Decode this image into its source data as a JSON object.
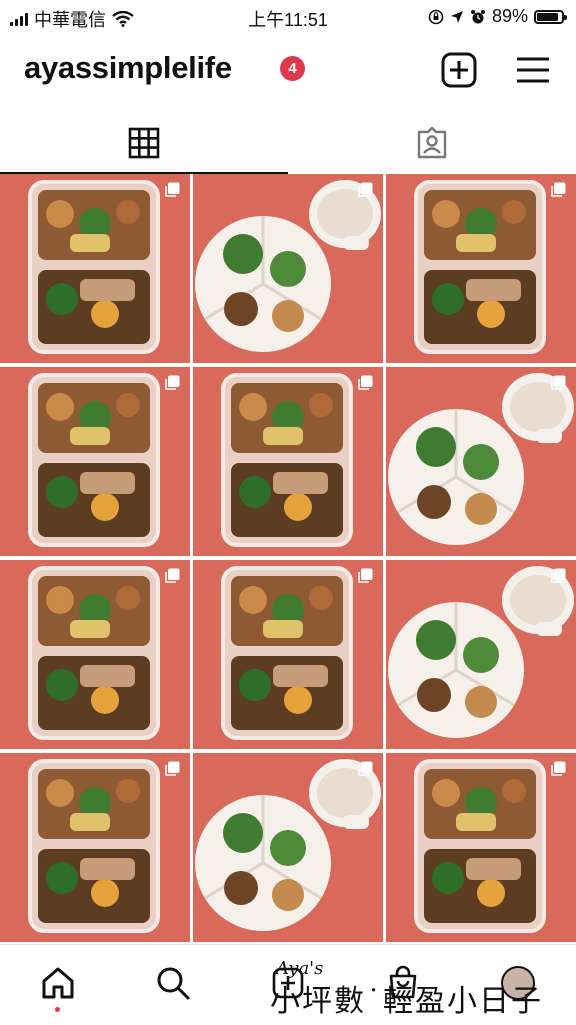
{
  "status_bar": {
    "carrier": "中華電信",
    "time": "上午11:51",
    "battery_percent": "89%",
    "battery_level": 0.89
  },
  "header": {
    "username": "ayassimplelife",
    "notification_count": "4",
    "icons": [
      "new-post-icon",
      "menu-icon"
    ]
  },
  "tabs": [
    {
      "name": "grid",
      "icon": "grid-icon",
      "active": true
    },
    {
      "name": "tagged",
      "icon": "tagged-icon",
      "active": false
    }
  ],
  "grid": {
    "posts": [
      {
        "type": "bento-box",
        "multi": true
      },
      {
        "type": "plate-with-drink",
        "multi": true
      },
      {
        "type": "bento-box",
        "multi": true
      },
      {
        "type": "bento-box",
        "multi": true
      },
      {
        "type": "bento-box",
        "multi": true
      },
      {
        "type": "plate-with-drink",
        "multi": true
      },
      {
        "type": "bento-box",
        "multi": true
      },
      {
        "type": "bento-box",
        "multi": true
      },
      {
        "type": "plate-with-drink",
        "multi": true
      },
      {
        "type": "bento-box",
        "multi": true
      },
      {
        "type": "plate-with-drink",
        "multi": true
      },
      {
        "type": "bento-box",
        "multi": true
      }
    ]
  },
  "watermark": {
    "line1": "Aya's",
    "line2": "小坪數˙輕盈小日子"
  },
  "bottom_nav": {
    "items": [
      "home-icon",
      "search-icon",
      "reels-icon",
      "shop-icon",
      "profile-avatar"
    ],
    "active": "home",
    "accent": "#e0384b"
  },
  "colors": {
    "accent": "#e0384b",
    "photo_background": "#d9695a"
  }
}
